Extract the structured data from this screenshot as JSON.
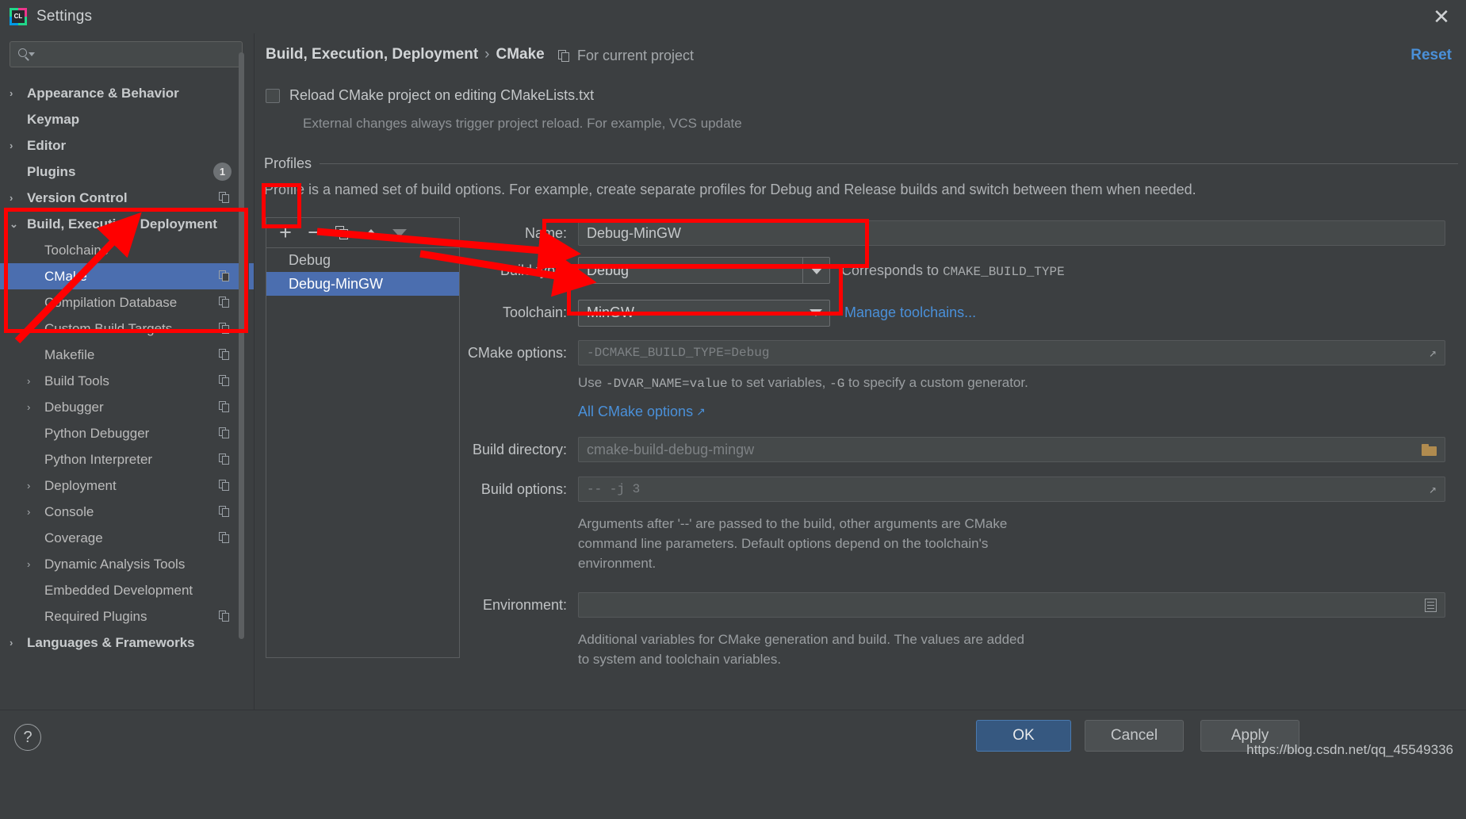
{
  "window": {
    "title": "Settings",
    "logo_text": "CL",
    "close_label": "✕"
  },
  "search": {
    "placeholder": "",
    "value": "",
    "icon": "search-icon"
  },
  "sidebar": {
    "items": [
      {
        "label": "Appearance & Behavior",
        "arrow": "›",
        "level": 1,
        "bold": true,
        "selected": false,
        "badge": "",
        "copy": false
      },
      {
        "label": "Keymap",
        "arrow": "",
        "level": 1,
        "bold": true,
        "selected": false,
        "badge": "",
        "copy": false
      },
      {
        "label": "Editor",
        "arrow": "›",
        "level": 1,
        "bold": true,
        "selected": false,
        "badge": "",
        "copy": false
      },
      {
        "label": "Plugins",
        "arrow": "",
        "level": 1,
        "bold": true,
        "selected": false,
        "badge": "1",
        "copy": false
      },
      {
        "label": "Version Control",
        "arrow": "›",
        "level": 1,
        "bold": true,
        "selected": false,
        "badge": "",
        "copy": true
      },
      {
        "label": "Build, Execution, Deployment",
        "arrow": "⌄",
        "level": 1,
        "bold": true,
        "selected": false,
        "badge": "",
        "copy": false
      },
      {
        "label": "Toolchains",
        "arrow": "",
        "level": 2,
        "bold": false,
        "selected": false,
        "badge": "",
        "copy": false
      },
      {
        "label": "CMake",
        "arrow": "",
        "level": 2,
        "bold": false,
        "selected": true,
        "badge": "",
        "copy": true
      },
      {
        "label": "Compilation Database",
        "arrow": "",
        "level": 2,
        "bold": false,
        "selected": false,
        "badge": "",
        "copy": true
      },
      {
        "label": "Custom Build Targets",
        "arrow": "",
        "level": 2,
        "bold": false,
        "selected": false,
        "badge": "",
        "copy": true
      },
      {
        "label": "Makefile",
        "arrow": "",
        "level": 2,
        "bold": false,
        "selected": false,
        "badge": "",
        "copy": true
      },
      {
        "label": "Build Tools",
        "arrow": "›",
        "level": 2,
        "bold": false,
        "selected": false,
        "badge": "",
        "copy": true
      },
      {
        "label": "Debugger",
        "arrow": "›",
        "level": 2,
        "bold": false,
        "selected": false,
        "badge": "",
        "copy": true
      },
      {
        "label": "Python Debugger",
        "arrow": "",
        "level": 2,
        "bold": false,
        "selected": false,
        "badge": "",
        "copy": true
      },
      {
        "label": "Python Interpreter",
        "arrow": "",
        "level": 2,
        "bold": false,
        "selected": false,
        "badge": "",
        "copy": true
      },
      {
        "label": "Deployment",
        "arrow": "›",
        "level": 2,
        "bold": false,
        "selected": false,
        "badge": "",
        "copy": true
      },
      {
        "label": "Console",
        "arrow": "›",
        "level": 2,
        "bold": false,
        "selected": false,
        "badge": "",
        "copy": true
      },
      {
        "label": "Coverage",
        "arrow": "",
        "level": 2,
        "bold": false,
        "selected": false,
        "badge": "",
        "copy": true
      },
      {
        "label": "Dynamic Analysis Tools",
        "arrow": "›",
        "level": 2,
        "bold": false,
        "selected": false,
        "badge": "",
        "copy": false
      },
      {
        "label": "Embedded Development",
        "arrow": "",
        "level": 2,
        "bold": false,
        "selected": false,
        "badge": "",
        "copy": false
      },
      {
        "label": "Required Plugins",
        "arrow": "",
        "level": 2,
        "bold": false,
        "selected": false,
        "badge": "",
        "copy": true
      },
      {
        "label": "Languages & Frameworks",
        "arrow": "›",
        "level": 1,
        "bold": true,
        "selected": false,
        "badge": "",
        "copy": false
      }
    ]
  },
  "header": {
    "breadcrumb_root": "Build, Execution, Deployment",
    "breadcrumb_sep": "›",
    "breadcrumb_leaf": "CMake",
    "for_current_project": "For current project",
    "reset": "Reset"
  },
  "options": {
    "reload_checkbox_label": "Reload CMake project on editing CMakeLists.txt",
    "reload_checkbox_checked": false,
    "reload_hint": "External changes always trigger project reload. For example, VCS update"
  },
  "profiles": {
    "legend": "Profiles",
    "description": "Profile is a named set of build options. For example, create separate profiles for Debug and Release builds and switch between them when needed.",
    "toolbar": {
      "add": "+",
      "remove": "−",
      "copy": "copy-icon",
      "move_up": "move-up-icon",
      "move_down": "move-down-icon"
    },
    "items": [
      {
        "label": "Debug",
        "selected": false
      },
      {
        "label": "Debug-MinGW",
        "selected": true
      }
    ]
  },
  "form": {
    "name_label": "Name:",
    "name_value": "Debug-MinGW",
    "build_type_label": "Build type:",
    "build_type_value": "Debug",
    "build_type_note_prefix": "Corresponds to ",
    "build_type_note_code": "CMAKE_BUILD_TYPE",
    "toolchain_label": "Toolchain:",
    "toolchain_value": "MinGW",
    "manage_toolchains_link": "Manage toolchains...",
    "cmake_options_label": "CMake options:",
    "cmake_options_placeholder": "-DCMAKE_BUILD_TYPE=Debug",
    "cmake_hint_a": "Use ",
    "cmake_hint_code1": "-DVAR_NAME=value",
    "cmake_hint_b": " to set variables, ",
    "cmake_hint_code2": "-G",
    "cmake_hint_c": " to specify a custom generator.",
    "all_cmake_options_link": "All CMake options",
    "all_cmake_options_arrow": "↗",
    "build_dir_label": "Build directory:",
    "build_dir_placeholder": "cmake-build-debug-mingw",
    "build_options_label": "Build options:",
    "build_options_placeholder": "-- -j 3",
    "build_options_hint": "Arguments after '--' are passed to the build, other arguments are CMake command line parameters. Default options depend on the toolchain's environment.",
    "environment_label": "Environment:",
    "environment_value": "",
    "environment_hint": "Additional variables for CMake generation and build. The values are added to system and toolchain variables."
  },
  "footer": {
    "help": "?",
    "ok": "OK",
    "cancel": "Cancel",
    "apply": "Apply",
    "watermark": "https://blog.csdn.net/qq_45549336"
  },
  "colors": {
    "accent_blue": "#4b6eaf",
    "link_blue": "#4a90d9",
    "annotation_red": "#ff0000",
    "panel_bg": "#3c3f41",
    "field_bg": "#45494a"
  }
}
